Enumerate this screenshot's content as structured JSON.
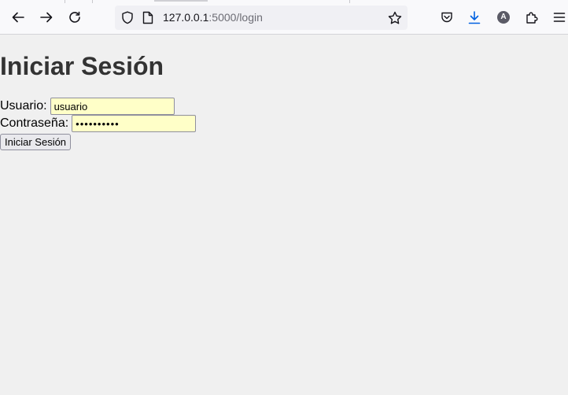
{
  "browser": {
    "url": {
      "host": "127.0.0.1",
      "rest": ":5000/login"
    },
    "account_initial": "A",
    "icons": {
      "back": "arrow-left-icon",
      "forward": "arrow-right-icon",
      "reload": "reload-icon",
      "tracking_protection": "shield-icon",
      "page_info": "page-icon",
      "bookmark": "star-icon",
      "pocket": "pocket-icon",
      "downloads": "download-icon",
      "extensions": "puzzle-icon",
      "menu": "hamburger-menu-icon"
    },
    "colors": {
      "download_accent": "#0061e0",
      "account_bg": "#5b5b66"
    }
  },
  "page": {
    "title": "Iniciar Sesión",
    "form": {
      "username_label": "Usuario:",
      "username_value": "usuario",
      "password_label": "Contraseña:",
      "password_value": "1234567890",
      "submit_label": "Iniciar Sesión"
    },
    "colors": {
      "background": "#f0f0f0",
      "heading": "#333333",
      "autofill_field": "#ffffc8"
    }
  }
}
